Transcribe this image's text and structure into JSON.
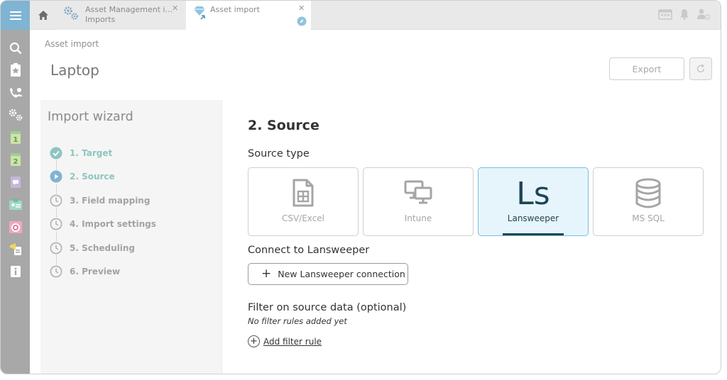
{
  "tabs": [
    {
      "title": "Asset Management i...",
      "subtitle": "Imports",
      "icon": "gears-icon"
    },
    {
      "title": "Asset import",
      "icon": "diamond-import-icon"
    }
  ],
  "breadcrumb": "Asset import",
  "page_title": "Laptop",
  "header": {
    "export_label": "Export"
  },
  "wizard": {
    "title": "Import wizard",
    "steps": [
      {
        "label": "1. Target",
        "state": "done"
      },
      {
        "label": "2. Source",
        "state": "active"
      },
      {
        "label": "3. Field mapping",
        "state": "pending"
      },
      {
        "label": "4. Import settings",
        "state": "pending"
      },
      {
        "label": "5. Scheduling",
        "state": "pending"
      },
      {
        "label": "6. Preview",
        "state": "pending"
      }
    ]
  },
  "main": {
    "section_title": "2. Source",
    "source_type_label": "Source type",
    "source_types": [
      {
        "label": "CSV/Excel",
        "icon": "spreadsheet-file-icon"
      },
      {
        "label": "Intune",
        "icon": "monitors-icon"
      },
      {
        "label": "Lansweeper",
        "icon": "lansweeper-logo-icon",
        "logo_text": "Ls",
        "selected": true
      },
      {
        "label": "MS SQL",
        "icon": "database-icon"
      }
    ],
    "connect_label": "Connect to Lansweeper",
    "new_connection_label": "New Lansweeper connection",
    "filter_label": "Filter on source data (optional)",
    "filter_empty": "No filter rules added yet",
    "add_filter_label": "Add filter rule"
  },
  "colors": {
    "accent_blue": "#7fb4d2",
    "selected_bg": "#e6f5fb",
    "step_done": "#8ec5bf",
    "lansweeper_dark": "#1d4656"
  }
}
